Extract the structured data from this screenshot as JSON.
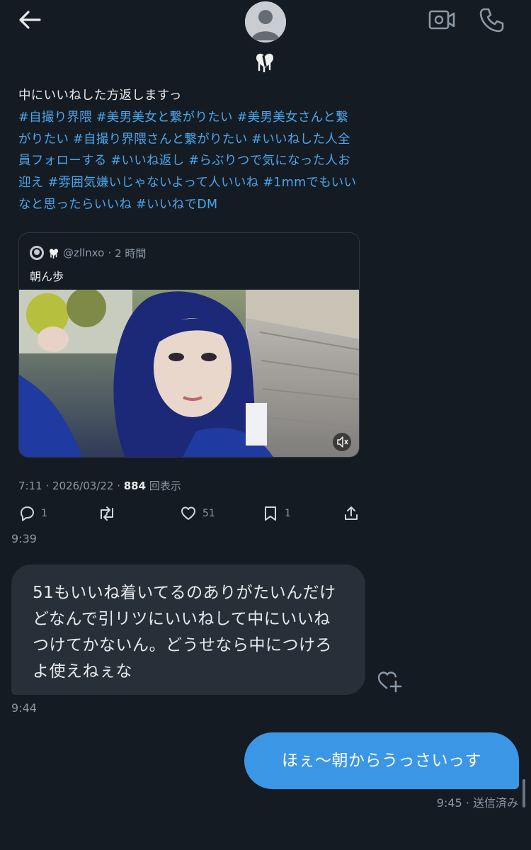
{
  "header": {
    "back_icon": "arrow-left-icon",
    "avatar_icon": "default-avatar-icon",
    "video_icon": "video-camera-icon",
    "call_icon": "phone-icon",
    "badge_icon": "dripping-heart-icon"
  },
  "tweet": {
    "text_plain": "中にいいねした方返しますっ",
    "hashtags": "#自撮り界隈 #美男美女と繋がりたい #美男美女さんと繋がりたい #自撮り界隈さんと繋がりたい #いいねした人全員フォローする #いいね返し #らぶりつで気になった人お迎え #雰囲気嫌いじゃないよって人いいね #1mmでもいいなと思ったらいいね #いいねでDM",
    "quote": {
      "handle": "@zllnxo",
      "separator": "·",
      "time": "2 時間",
      "text": "朝ん歩",
      "media_icon": "video-thumbnail",
      "mute_icon": "speaker-muted-icon"
    },
    "meta_prefix": "7:11 · 2026/03/22 · ",
    "views_count": "884",
    "views_label": " 回表示",
    "actions": {
      "reply_icon": "reply-icon",
      "reply_count": "1",
      "retweet_icon": "retweet-icon",
      "like_icon": "heart-icon",
      "like_count": "51",
      "bookmark_icon": "bookmark-icon",
      "bookmark_count": "1",
      "share_icon": "share-icon"
    }
  },
  "messages": {
    "time_1": "9:39",
    "incoming_text": "51もいいね着いてるのありがたいんだけどなんで引リツにいいねして中にいいねつけてかないん。どうせなら中につけろよ使えねぇな",
    "time_2": "9:44",
    "react_icon": "heart-plus-icon",
    "outgoing_text": "ほぇ〜朝からうっさいっす",
    "time_3": "9:45",
    "status": " · 送信済み"
  },
  "colors": {
    "background": "#151b23",
    "hashtag": "#4aa6ea",
    "outgoing_bubble": "#3b96e6",
    "incoming_bubble": "#273039"
  }
}
